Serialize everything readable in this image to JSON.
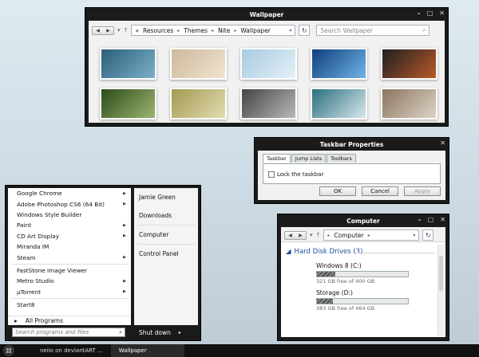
{
  "wallpaper_window": {
    "title": "Wallpaper",
    "breadcrumb": [
      "Resources",
      "Themes",
      "Nite",
      "Wallpaper"
    ],
    "search_placeholder": "Search Wallpaper",
    "thumbnails": [
      {
        "name": "tiles-blue",
        "colors": [
          "#2c5e7a",
          "#7ab0c8"
        ]
      },
      {
        "name": "tiles-beige",
        "colors": [
          "#cdb89c",
          "#f0e4d0"
        ]
      },
      {
        "name": "sky-blue",
        "colors": [
          "#a7cbe1",
          "#e5f0f7"
        ]
      },
      {
        "name": "blue-tent",
        "colors": [
          "#0f3f7c",
          "#6fb3e8"
        ]
      },
      {
        "name": "dark-orange",
        "colors": [
          "#1e1e22",
          "#b85a28"
        ]
      },
      {
        "name": "grass-green",
        "colors": [
          "#2d4b1c",
          "#9bb56f"
        ]
      },
      {
        "name": "dandelion",
        "colors": [
          "#a39a51",
          "#e3dcb2"
        ]
      },
      {
        "name": "gray-wood",
        "colors": [
          "#444444",
          "#b8b8b8"
        ]
      },
      {
        "name": "teal-bokeh",
        "colors": [
          "#2b6f7e",
          "#d5e8ec"
        ]
      },
      {
        "name": "stone-wall",
        "colors": [
          "#8a7560",
          "#ddd3c4"
        ]
      }
    ]
  },
  "taskbar_properties": {
    "title": "Taskbar Properties",
    "tabs": [
      "Taskbar",
      "Jump Lists",
      "Toolbars"
    ],
    "checkbox_label": "Lock the taskbar",
    "buttons": {
      "ok": "OK",
      "cancel": "Cancel",
      "apply": "Apply"
    }
  },
  "computer_window": {
    "title": "Computer",
    "address": "Computer",
    "group_header": "Hard Disk Drives (3)",
    "drives": [
      {
        "name": "Windows 8 (C:)",
        "free_text": "321 GB free of 400 GB",
        "used_fraction": 0.2
      },
      {
        "name": "Storage (D:)",
        "free_text": "383 GB free of 464 GB",
        "used_fraction": 0.175
      }
    ]
  },
  "start_menu": {
    "programs": [
      {
        "label": "Google Chrome",
        "submenu": true
      },
      {
        "label": "Adobe Photoshop CS6 (64 Bit)",
        "submenu": true
      },
      {
        "label": "Windows Style Builder",
        "submenu": false
      },
      {
        "label": "Paint",
        "submenu": true
      },
      {
        "label": "CD Art Display",
        "submenu": true
      },
      {
        "label": "Miranda IM",
        "submenu": false
      },
      {
        "label": "Steam",
        "submenu": true
      },
      {
        "label": "FastStone Image Viewer",
        "submenu": false
      },
      {
        "label": "Metro Studio",
        "submenu": true
      },
      {
        "label": "µTorrent",
        "submenu": true
      },
      {
        "label": "Start8",
        "submenu": false
      }
    ],
    "all_programs": "All Programs",
    "right_links": [
      "Jamie Green",
      "Downloads",
      "Computer",
      "Control Panel"
    ],
    "search_placeholder": "Search programs and files",
    "shutdown": "Shut down"
  },
  "taskbar": {
    "items": [
      "neiio on deviantART ...",
      "Wallpaper"
    ]
  }
}
